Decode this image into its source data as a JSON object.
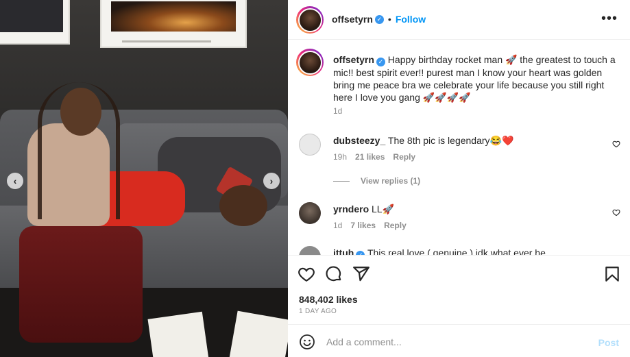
{
  "post": {
    "username": "offsetyrn",
    "verified_badge": "✓",
    "separator": "•",
    "follow_label": "Follow",
    "more_icon": "•••"
  },
  "caption": {
    "username": "offsetyrn",
    "text": "Happy birthday rocket man 🚀 the greatest to touch a mic!! best spirit ever!! purest man I know your heart was golden bring me peace bra we celebrate your life because you still right here I love you gang 🚀🚀🚀🚀",
    "time": "1d"
  },
  "comments": [
    {
      "username": "dubsteezy_",
      "text": "The 8th pic is legendary😂❤️",
      "time": "19h",
      "likes": "21 likes",
      "reply_label": "Reply",
      "view_replies": "View replies (1)"
    },
    {
      "username": "yrndero",
      "text": "LL🚀",
      "time": "1d",
      "likes": "7 likes",
      "reply_label": "Reply"
    },
    {
      "username": "ittuh",
      "text": "This real love ( genuine ) idk what ever he"
    }
  ],
  "stats": {
    "likes": "848,402 likes",
    "date": "1 DAY AGO"
  },
  "composer": {
    "placeholder": "Add a comment...",
    "post_label": "Post"
  },
  "carousel": {
    "prev_icon": "‹",
    "next_icon": "›"
  },
  "icons": [
    "heart-icon",
    "comment-icon",
    "share-icon",
    "bookmark-icon",
    "emoji-icon",
    "verified-icon",
    "more-icon"
  ],
  "colors": {
    "accent": "#0095f6",
    "verified": "#3897f0",
    "muted": "#8e8e8e",
    "post_disabled": "#b2dffc"
  }
}
